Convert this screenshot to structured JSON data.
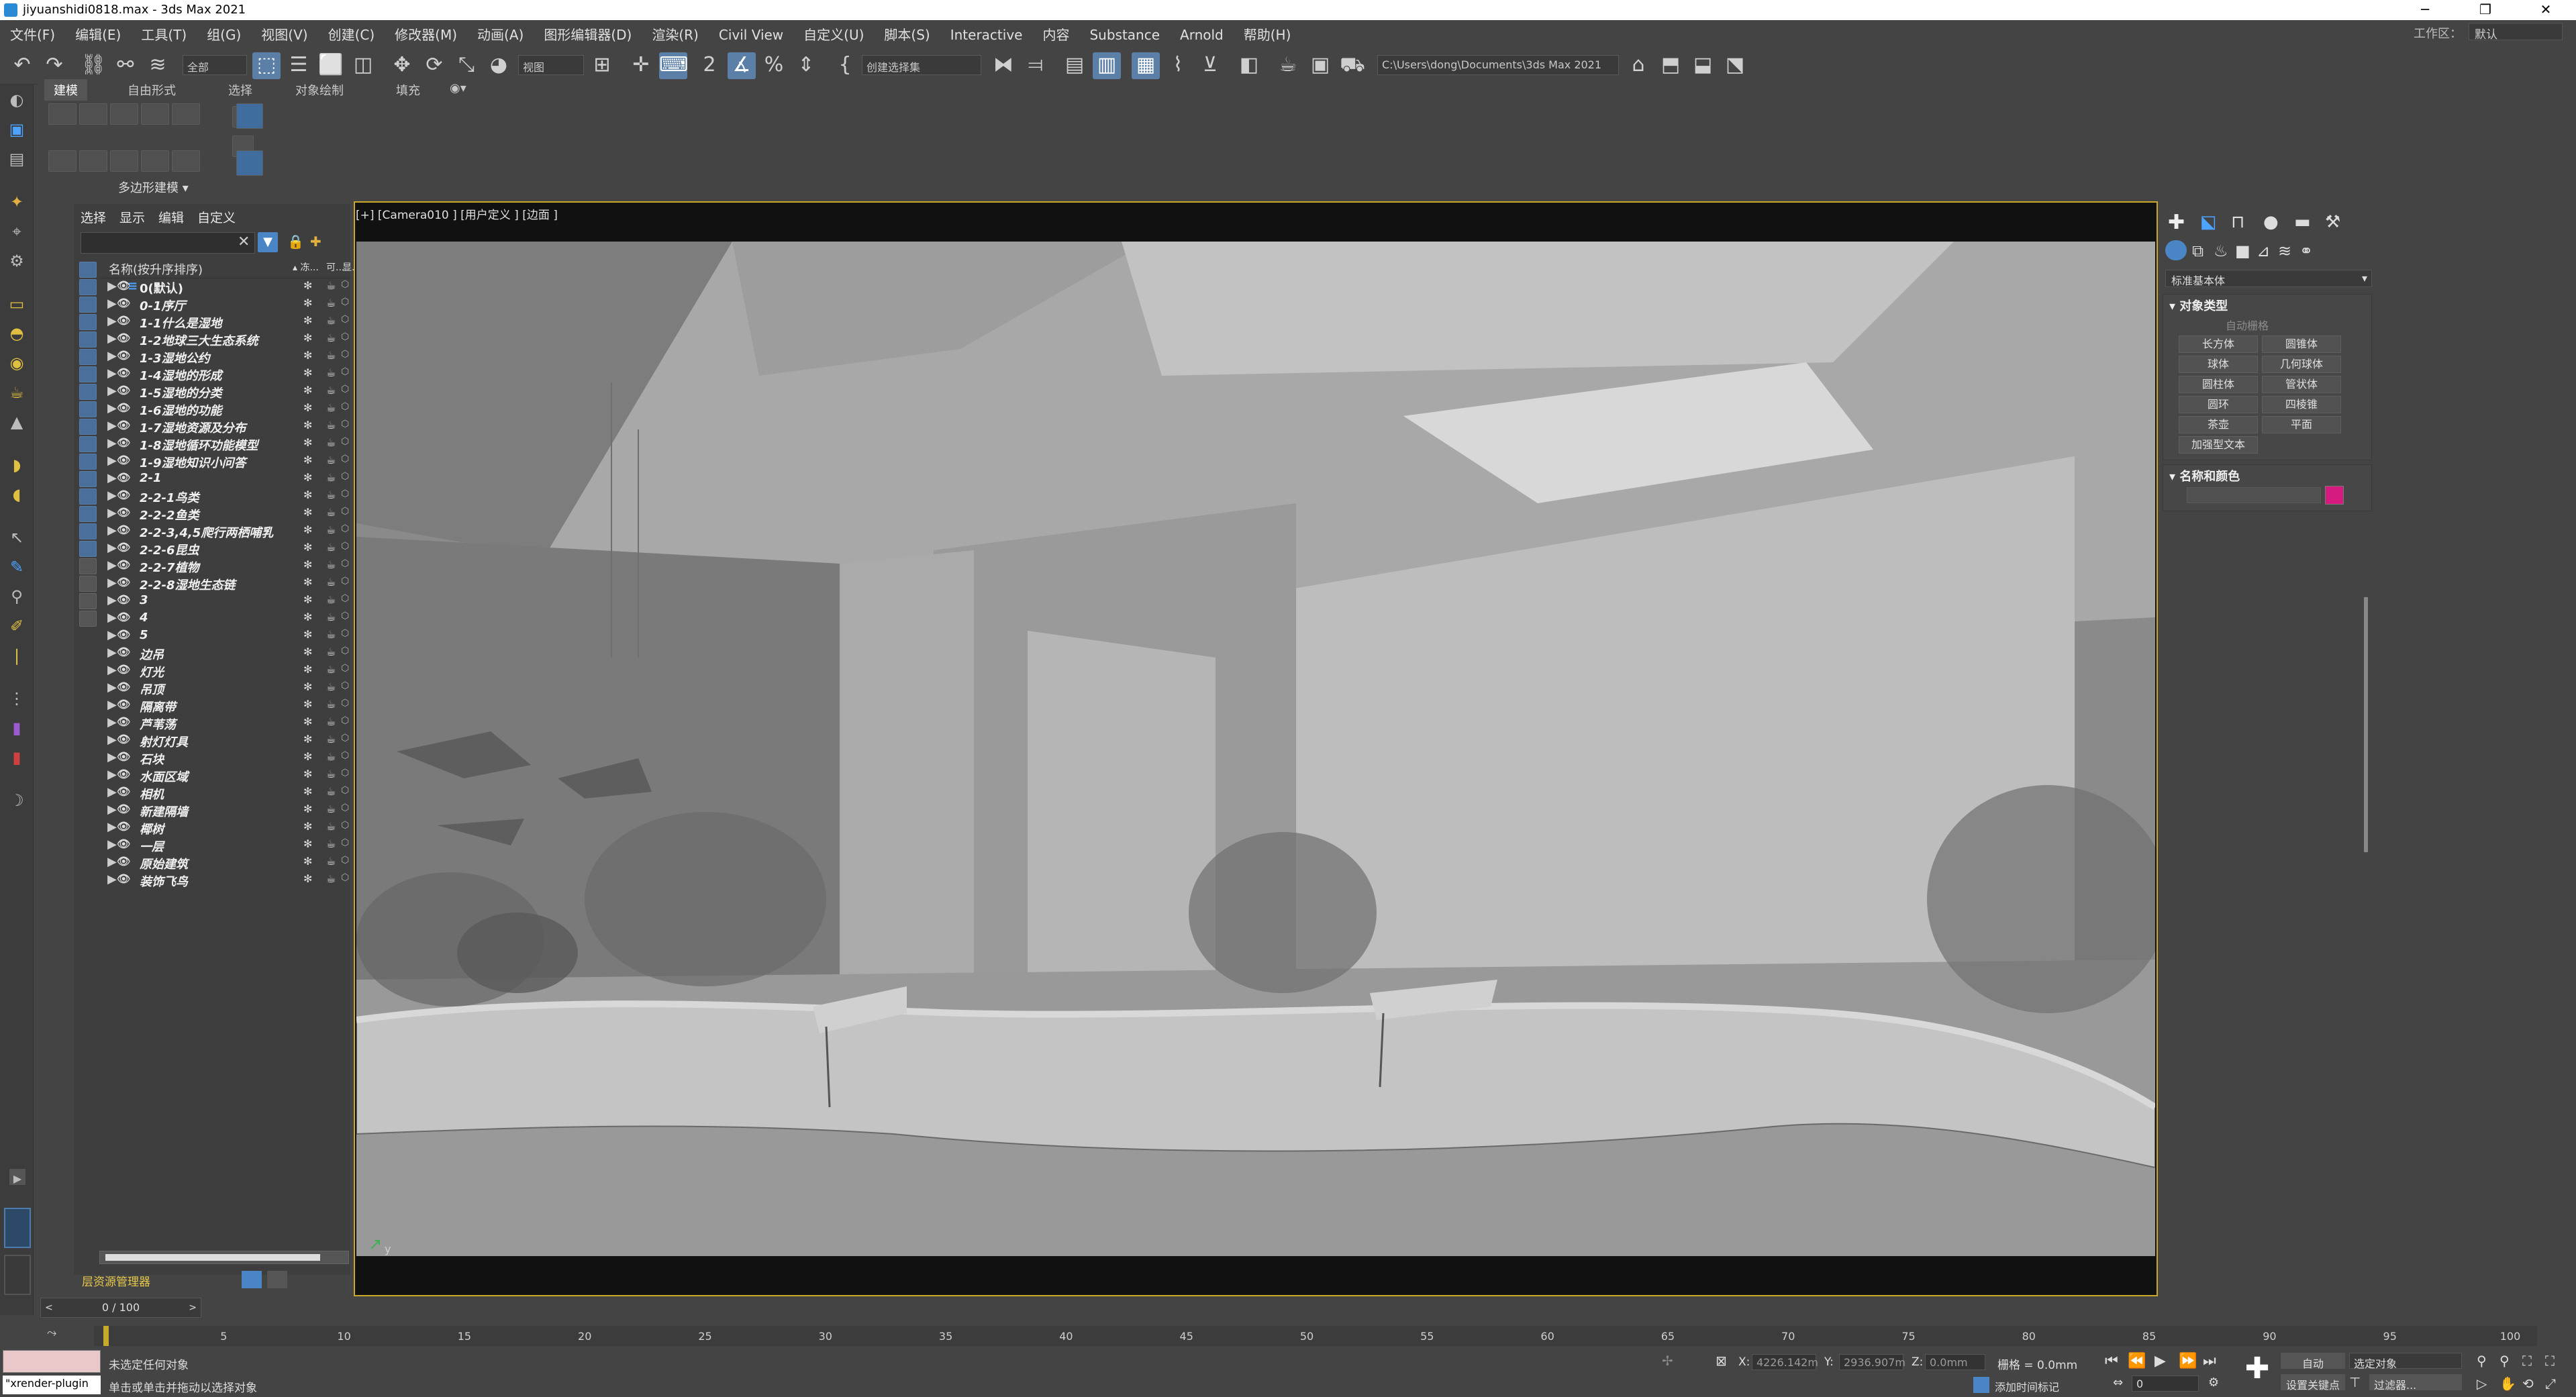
{
  "window": {
    "title": "jiyuanshidi0818.max - 3ds Max 2021",
    "controls": [
      "─",
      "❐",
      "✕"
    ]
  },
  "menu": {
    "items": [
      "文件(F)",
      "编辑(E)",
      "工具(T)",
      "组(G)",
      "视图(V)",
      "创建(C)",
      "修改器(M)",
      "动画(A)",
      "图形编辑器(D)",
      "渲染(R)",
      "Civil View",
      "自定义(U)",
      "脚本(S)",
      "Interactive",
      "内容",
      "Substance",
      "Arnold",
      "帮助(H)"
    ],
    "workspace_label": "工作区：",
    "workspace_value": "默认"
  },
  "toolbar": {
    "filter": "全部",
    "refcoord": "视图",
    "selection_set": "创建选择集",
    "path": "C:\\Users\\dong\\Documents\\3ds Max 2021"
  },
  "ribbon": {
    "tabs": [
      "建模",
      "自由形式",
      "选择",
      "对象绘制",
      "填充"
    ],
    "panel_label": "多边形建模 ▾"
  },
  "explorer": {
    "tabs": [
      "选择",
      "显示",
      "编辑",
      "自定义"
    ],
    "col_name": "名称(按升序排序)",
    "col_hdr_icons": [
      "▴ 冻...",
      "可...",
      "显..."
    ],
    "rows": [
      {
        "name": "0(默认)",
        "layer": true
      },
      {
        "name": "0-1序厅"
      },
      {
        "name": "1-1什么是湿地"
      },
      {
        "name": "1-2地球三大生态系统"
      },
      {
        "name": "1-3湿地公约"
      },
      {
        "name": "1-4湿地的形成"
      },
      {
        "name": "1-5湿地的分类"
      },
      {
        "name": "1-6湿地的功能"
      },
      {
        "name": "1-7湿地资源及分布"
      },
      {
        "name": "1-8湿地循环功能模型"
      },
      {
        "name": "1-9湿地知识小问答"
      },
      {
        "name": "2-1"
      },
      {
        "name": "2-2-1鸟类"
      },
      {
        "name": "2-2-2鱼类"
      },
      {
        "name": "2-2-3,4,5爬行两栖哺乳"
      },
      {
        "name": "2-2-6昆虫"
      },
      {
        "name": "2-2-7植物"
      },
      {
        "name": "2-2-8湿地生态链"
      },
      {
        "name": "3"
      },
      {
        "name": "4"
      },
      {
        "name": "5"
      },
      {
        "name": "边吊"
      },
      {
        "name": "灯光"
      },
      {
        "name": "吊顶"
      },
      {
        "name": "隔离带"
      },
      {
        "name": "芦苇荡"
      },
      {
        "name": "射灯灯具"
      },
      {
        "name": "石块"
      },
      {
        "name": "水面区域"
      },
      {
        "name": "相机"
      },
      {
        "name": "新建隔墙"
      },
      {
        "name": "椰树"
      },
      {
        "name": "一层"
      },
      {
        "name": "原始建筑"
      },
      {
        "name": "装饰飞鸟"
      }
    ],
    "footer": "层资源管理器"
  },
  "viewport": {
    "label": "[+] [Camera010 ] [用户定义 ] [边面 ]",
    "axis_label": "y"
  },
  "timeline": {
    "slider": "0 / 100",
    "ticks": [
      "5",
      "10",
      "15",
      "20",
      "25",
      "30",
      "35",
      "40",
      "45",
      "50",
      "55",
      "60",
      "65",
      "70",
      "75",
      "80",
      "85",
      "90",
      "95",
      "100"
    ]
  },
  "status": {
    "msg1": "未选定任何对象",
    "msg2": "单击或单击并拖动以选择对象",
    "script": "\"xrender-plugin",
    "x_label": "X:",
    "x_value": "4226.142m",
    "y_label": "Y:",
    "y_value": "2936.907m",
    "z_label": "Z:",
    "z_value": "0.0mm",
    "grid": "栅格 = 0.0mm",
    "add_time_tag": "添加时间标记",
    "auto": "自动",
    "set_key": "设置关键点",
    "selected": "选定对象",
    "filter": "过滤器...",
    "frame": "0"
  },
  "cmdpanel": {
    "dropdown": "标准基本体",
    "section1": "对象类型",
    "autogrid": "自动栅格",
    "buttons": [
      "长方体",
      "圆锥体",
      "球体",
      "几何球体",
      "圆柱体",
      "管状体",
      "圆环",
      "四棱锥",
      "茶壶",
      "平面",
      "加强型文本"
    ],
    "section2": "名称和颜色",
    "color": "#d61a7f"
  },
  "colors": {
    "accent": "#5b7fa6",
    "viewport_border": "#c8a92a",
    "layer_footer": "#e6c84a"
  }
}
